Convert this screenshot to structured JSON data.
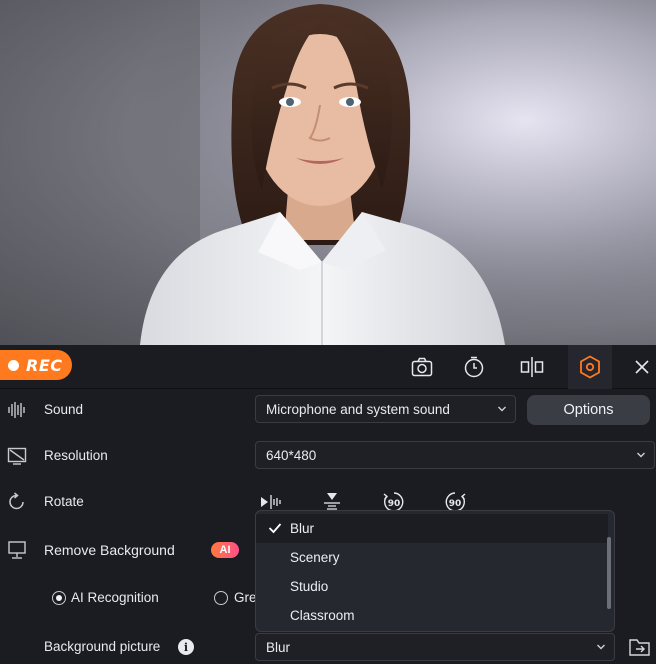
{
  "record": {
    "label": "REC",
    "accent": "#ff7a1f"
  },
  "toolbar": {
    "icons": [
      "camera-icon",
      "timer-icon",
      "split-view-icon",
      "settings-hexagon-icon",
      "close-icon"
    ]
  },
  "settings": {
    "sound": {
      "label": "Sound",
      "value": "Microphone and system sound",
      "options_label": "Options"
    },
    "resolution": {
      "label": "Resolution",
      "value": "640*480"
    },
    "rotate": {
      "label": "Rotate",
      "rotate_left": "90",
      "rotate_right": "90"
    },
    "remove_background": {
      "label": "Remove Background",
      "ai_badge": "AI"
    },
    "mode": {
      "ai_recognition": "AI Recognition",
      "green_screen": "Gre"
    },
    "background_picture": {
      "label": "Background picture",
      "info": "i",
      "value": "Blur"
    }
  },
  "dropdown": {
    "items": [
      "Blur",
      "Scenery",
      "Studio",
      "Classroom"
    ],
    "selected": "Blur"
  }
}
